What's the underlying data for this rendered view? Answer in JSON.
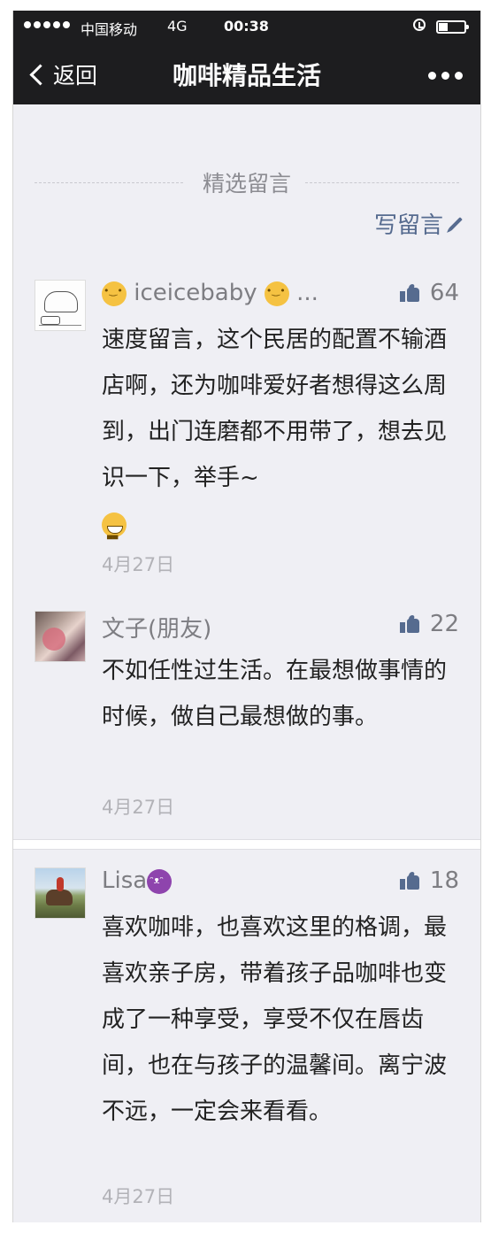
{
  "status_bar": {
    "carrier": "中国移动",
    "network": "4G",
    "time": "00:38"
  },
  "nav": {
    "back_label": "返回",
    "title": "咖啡精品生活"
  },
  "section": {
    "title": "精选留言",
    "write_label": "写留言"
  },
  "comments": [
    {
      "name": "iceicebaby",
      "name_suffix": "...",
      "likes": "64",
      "text": "速度留言，这个民居的配置不输酒店啊，还为咖啡爱好者想得这么周到，出门连磨都不用带了，想去见识一下，举手~",
      "date": "4月27日"
    },
    {
      "name": "文子(朋友)",
      "likes": "22",
      "text": "不如任性过生活。在最想做事情的时候，做自己最想做的事。",
      "date": "4月27日"
    },
    {
      "name": "Lisa",
      "likes": "18",
      "text": "喜欢咖啡，也喜欢这里的格调，最喜欢亲子房，带着孩子品咖啡也变成了一种享受，享受不仅在唇齿间，也在与孩子的温馨间。离宁波不远，一定会来看看。",
      "date": "4月27日"
    }
  ],
  "colors": {
    "nav_bg": "#1d1d1f",
    "page_bg": "#efeff4",
    "link": "#566b8f",
    "meta": "#7d7d82",
    "date": "#b2b2b7"
  },
  "icons": [
    "signal-dots-icon",
    "alarm-icon",
    "battery-icon",
    "back-chevron-icon",
    "more-icon",
    "pencil-icon",
    "thumbs-up-icon",
    "cat-emoji-icon",
    "grin-emoji-icon",
    "devil-emoji-icon"
  ]
}
